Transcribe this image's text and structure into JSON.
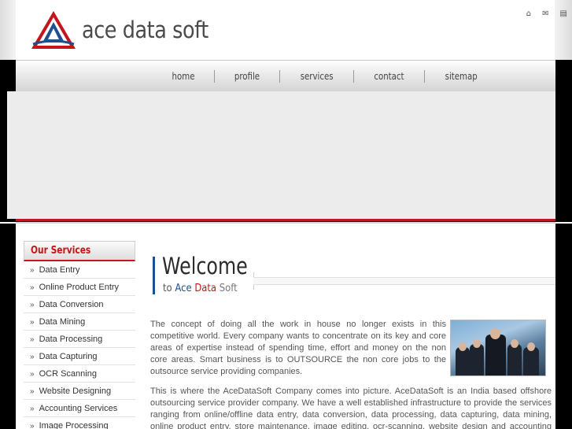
{
  "brand": {
    "name": "ace data soft",
    "colors": {
      "red": "#c4151c",
      "blue": "#1f4f8f"
    }
  },
  "top_icons": [
    "home-icon",
    "mail-icon",
    "sitemap-icon"
  ],
  "nav": {
    "items": [
      "home",
      "profile",
      "services",
      "contact",
      "sitemap"
    ]
  },
  "sidebar": {
    "title": "Our Services",
    "items": [
      "Data Entry",
      "Online Product Entry",
      "Data Conversion",
      "Data Mining",
      "Data Processing",
      "Data Capturing",
      "OCR Scanning",
      "Website Designing",
      "Accounting Services",
      "Image Processing"
    ]
  },
  "welcome": {
    "title": "Welcome",
    "to": "to",
    "ace": "Ace",
    "data": "Data",
    "soft": "Soft"
  },
  "content": {
    "para1": "The concept of doing all the work in house no longer exists in this competitive world. Every company wants to concentrate on its key and core areas of expertise instead of spending time, effort and money on the non core areas. Smart business is to OUTSOURCE the non core jobs to the outsource service providing companies.",
    "para2": "This is where the AceDataSoft Company comes into picture. AceDataSoft is an India based offshore outsourcing service provider company. We have a well established infrastructure to provide the services ranging from online/offline data entry, data conversion, data processing, data capturing, data mining, online product entry, store maintenance, image editing, ocr-scanning, website design and accounting services."
  }
}
